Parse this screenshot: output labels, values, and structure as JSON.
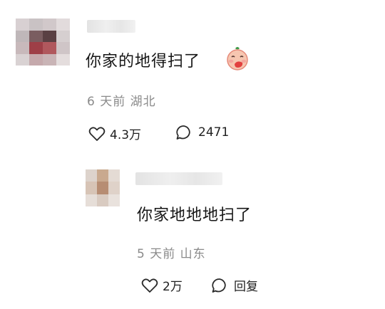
{
  "comment1": {
    "text": "你家的地得扫了",
    "location_date": "6 天前 湖北",
    "likes": "4.3万",
    "replies": "2471",
    "emoji": "face-with-hand-over-mouth"
  },
  "reply1": {
    "text": "你家地地地扫了",
    "location_date": "5 天前 山东",
    "likes": "2万",
    "reply_label": "回复"
  },
  "colors": {
    "meta_gray": "#8a8a8a",
    "text_dark": "#161616",
    "icon_dark": "#2a2a2a"
  }
}
